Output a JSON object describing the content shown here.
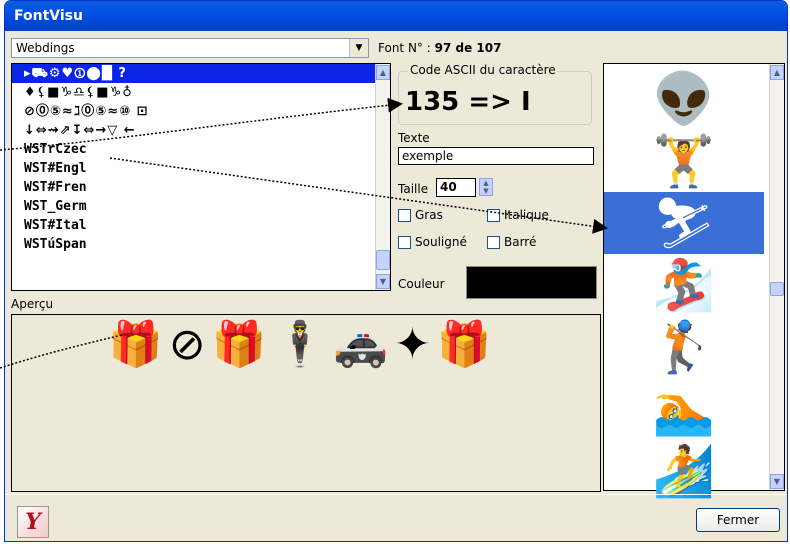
{
  "window": {
    "title": "FontVisu"
  },
  "font_selector": {
    "value": "Webdings",
    "arrow": "▼"
  },
  "font_number": {
    "label": "Font N° :",
    "value": "97 de 107"
  },
  "font_list": {
    "items": [
      {
        "text": "▸⛟⚙♥⓵⬤█ ?",
        "selected": true,
        "dingbat": true
      },
      {
        "text": "♦⚸■♑♎⚸■♑♁",
        "selected": false,
        "dingbat": true
      },
      {
        "text": "⊘⓪⑤≈ℷ⓪⑤≈⑩    ⊡",
        "selected": false,
        "dingbat": true
      },
      {
        "text": "  ↓⇔⇝⇗↧⇔→▽    ←",
        "selected": false,
        "dingbat": true
      },
      {
        "text": "WSTrCzec",
        "selected": false,
        "dingbat": false
      },
      {
        "text": "WST#Engl",
        "selected": false,
        "dingbat": false
      },
      {
        "text": "WST#Fren",
        "selected": false,
        "dingbat": false
      },
      {
        "text": "WST_Germ",
        "selected": false,
        "dingbat": false
      },
      {
        "text": "WST#Ital",
        "selected": false,
        "dingbat": false
      },
      {
        "text": "WSTúSpan",
        "selected": false,
        "dingbat": false
      }
    ]
  },
  "ascii_group": {
    "label": "Code ASCII du caractère",
    "value": "135 => I"
  },
  "texte": {
    "label": "Texte",
    "value": "exemple"
  },
  "taille": {
    "label": "Taille",
    "value": "40"
  },
  "options": {
    "gras": "Gras",
    "italique": "Italique",
    "souligne": "Souligné",
    "barre": "Barré"
  },
  "couleur": {
    "label": "Couleur",
    "value": "#000000"
  },
  "apercu": {
    "label": "Aperçu",
    "glyphs": "🎁⊘🎁🕴🚓✦🎁"
  },
  "glyph_panel": {
    "glyphs": [
      "👽",
      "🏋",
      "⛷",
      "🏂",
      "🏌",
      "🏊",
      "🏄"
    ],
    "selected_index": 2
  },
  "buttons": {
    "close": "Fermer"
  },
  "colors": {
    "title_bar": "#0050E6",
    "selection": "#0A24E8",
    "panel_selection": "#3A6FD6",
    "window_bg": "#ECE9D8"
  }
}
